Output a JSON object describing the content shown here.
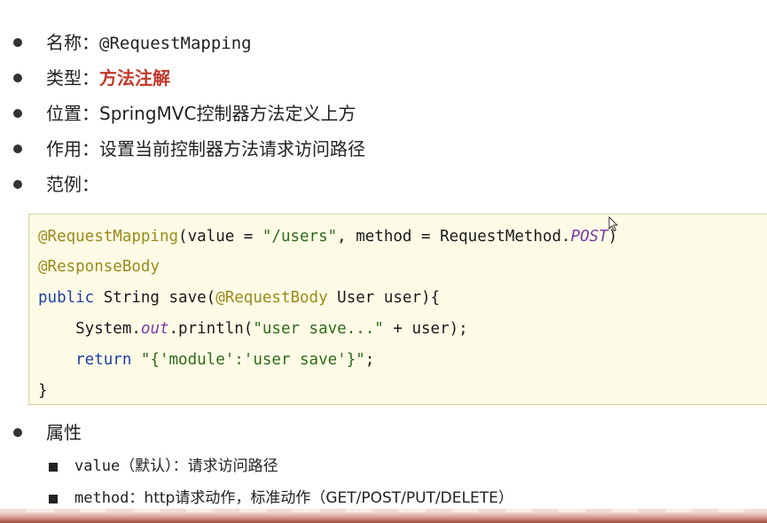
{
  "bullets": [
    {
      "key": "名称：",
      "value": "@RequestMapping"
    },
    {
      "key": "类型：",
      "value": "方法注解"
    },
    {
      "key": "位置：",
      "value": "SpringMVC控制器方法定义上方"
    },
    {
      "key": "作用：",
      "value": "设置当前控制器方法请求访问路径"
    },
    {
      "key": "范例：",
      "value": ""
    }
  ],
  "code": {
    "line1": {
      "ann": "@RequestMapping",
      "p1": "(value = ",
      "s1": "\"/users\"",
      "p2": ", method = RequestMethod.",
      "it": "POST",
      "p3": ")"
    },
    "line2": {
      "ann": "@ResponseBody"
    },
    "line3": {
      "kw": "public",
      "p1": " String save(",
      "ann": "@RequestBody",
      "p2": " User user){"
    },
    "line4": {
      "p1": "    System.",
      "it": "out",
      "p2": ".println(",
      "s1": "\"user save...\"",
      "p3": " + user);"
    },
    "line5": {
      "kw": "    return",
      "p1": " ",
      "s1": "\"{'module':'user save'}\"",
      "p2": ";"
    },
    "line6": {
      "p1": "}"
    }
  },
  "attributes": {
    "label": "属性",
    "items": [
      {
        "name": "value",
        "desc": "（默认）：请求访问路径"
      },
      {
        "name": "method",
        "desc": "：http请求动作，标准动作（GET/POST/PUT/DELETE）"
      }
    ]
  },
  "colors": {
    "highlight": "#c0392b",
    "code_background": "#fdfbe6",
    "annotation": "#9b8a1a",
    "keyword": "#1f3fa8",
    "string": "#2e6b1a"
  },
  "icons": [
    "bullet-dot-icon",
    "square-bullet-icon",
    "mouse-cursor-icon"
  ]
}
